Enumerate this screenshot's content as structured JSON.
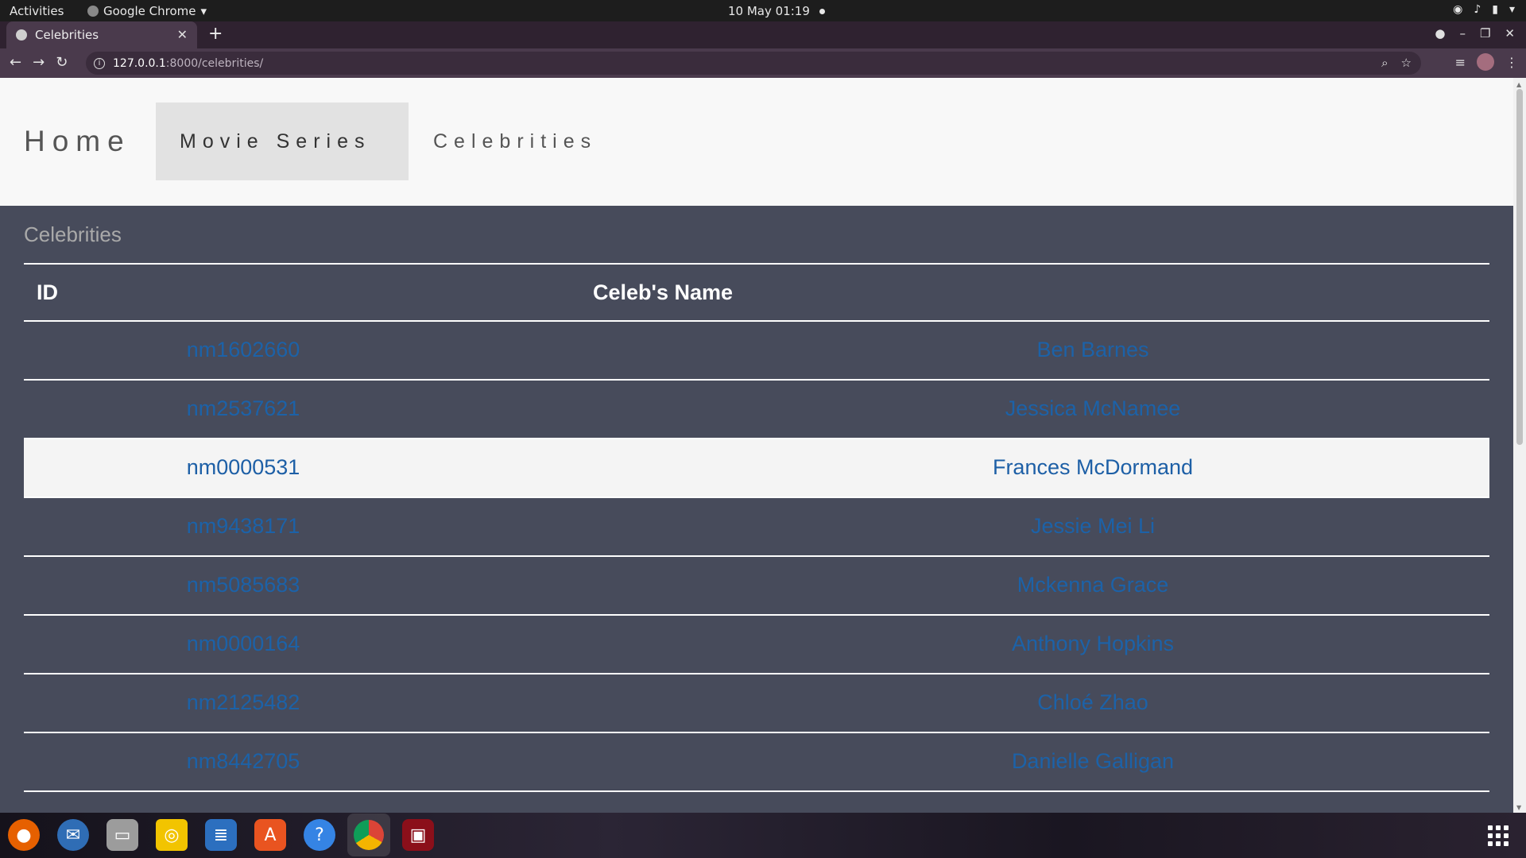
{
  "topbar": {
    "activities": "Activities",
    "app_name": "Google Chrome",
    "clock": "10 May  01:19"
  },
  "browser": {
    "tab_title": "Celebrities",
    "url_host": "127.0.0.1",
    "url_path": ":8000/celebrities/"
  },
  "navbar": {
    "home": "Home",
    "movie_series": "Movie Series",
    "celebrities": "Celebrities"
  },
  "main": {
    "section_title": "Celebrities",
    "headers": [
      "ID",
      "Celeb's Name"
    ],
    "rows": [
      {
        "id": "nm1602660",
        "name": "Ben Barnes"
      },
      {
        "id": "nm2537621",
        "name": "Jessica McNamee"
      },
      {
        "id": "nm0000531",
        "name": "Frances McDormand"
      },
      {
        "id": "nm9438171",
        "name": "Jessie Mei Li"
      },
      {
        "id": "nm5085683",
        "name": "Mckenna Grace"
      },
      {
        "id": "nm0000164",
        "name": "Anthony Hopkins"
      },
      {
        "id": "nm2125482",
        "name": "Chloé Zhao"
      },
      {
        "id": "nm8442705",
        "name": "Danielle Galligan"
      }
    ]
  },
  "dock": {
    "items": [
      "firefox-icon",
      "thunderbird-icon",
      "files-icon",
      "rhythmbox-icon",
      "writer-icon",
      "software-icon",
      "help-icon",
      "chrome-icon",
      "terminal-icon"
    ]
  },
  "colors": {
    "page_bg": "#474b5b",
    "navbar_bg": "#f8f8f8",
    "link": "#1c62a8",
    "header_text": "#ffffff",
    "highlight_row": "#f4f4f4"
  }
}
